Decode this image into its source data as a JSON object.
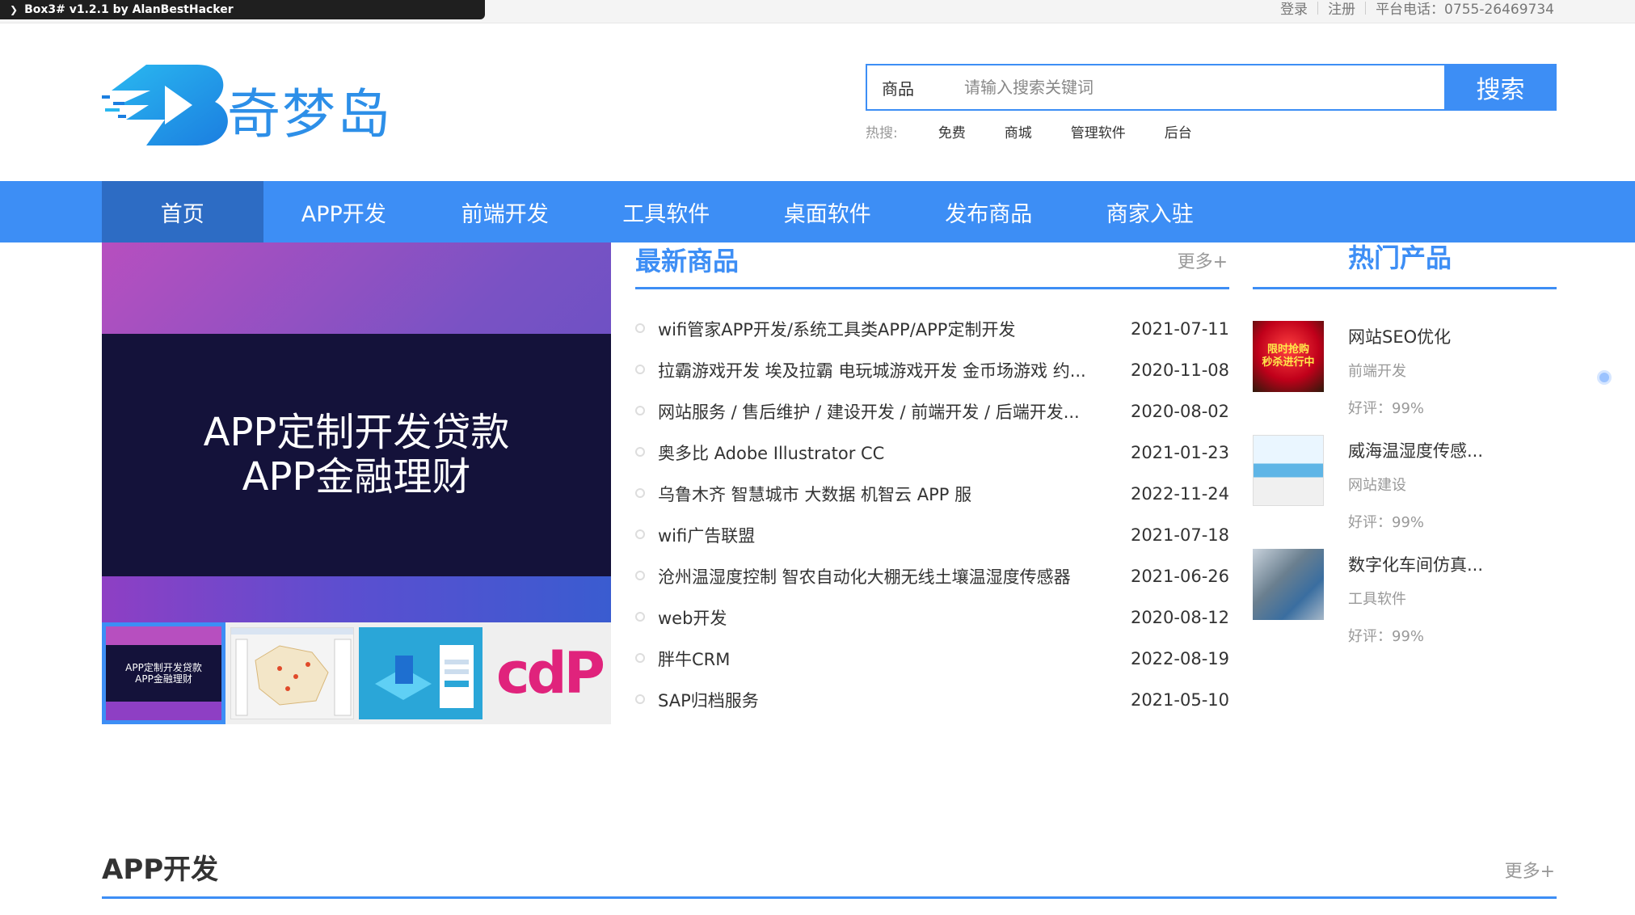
{
  "devbar": {
    "label": "Box3# v1.2.1 by AlanBestHacker"
  },
  "topbar": {
    "login": "登录",
    "register": "注册",
    "phone": "平台电话：0755-26469734"
  },
  "logo": {
    "text": "奇梦岛"
  },
  "search": {
    "category": "商品",
    "placeholder": "请输入搜索关键词",
    "button": "搜索"
  },
  "hot_search": {
    "label": "热搜:",
    "keywords": [
      "免费",
      "商城",
      "管理软件",
      "后台"
    ]
  },
  "nav": [
    "首页",
    "APP开发",
    "前端开发",
    "工具软件",
    "桌面软件",
    "发布商品",
    "商家入驻"
  ],
  "banner": {
    "line1": "APP定制开发贷款",
    "line2": "APP金融理财",
    "thumb1_line1": "APP定制开发贷款",
    "thumb1_line2": "APP金融理财",
    "thumb4_text": "cdP"
  },
  "latest": {
    "title": "最新商品",
    "more": "更多+",
    "items": [
      {
        "title": "wifi管家APP开发/系统工具类APP/APP定制开发",
        "date": "2021-07-11"
      },
      {
        "title": "拉霸游戏开发 埃及拉霸 电玩城游戏开发 金币场游戏 约...",
        "date": "2020-11-08"
      },
      {
        "title": "网站服务 / 售后维护 / 建设开发 / 前端开发 / 后端开发...",
        "date": "2020-08-02"
      },
      {
        "title": "奥多比 Adobe Illustrator CC",
        "date": "2021-01-23"
      },
      {
        "title": "乌鲁木齐 智慧城市 大数据 机智云 APP 服",
        "date": "2022-11-24"
      },
      {
        "title": "wifi广告联盟",
        "date": "2021-07-18"
      },
      {
        "title": "沧州温湿度控制 智农自动化大棚无线土壤温湿度传感器",
        "date": "2021-06-26"
      },
      {
        "title": "web开发",
        "date": "2020-08-12"
      },
      {
        "title": "胖牛CRM",
        "date": "2022-08-19"
      },
      {
        "title": "SAP归档服务",
        "date": "2021-05-10"
      }
    ]
  },
  "hot_products": {
    "title": "热门产品",
    "items": [
      {
        "name": "网站SEO优化",
        "category": "前端开发",
        "score": "好评：99%",
        "img_line1": "限时抢购",
        "img_line2": "秒杀进行中"
      },
      {
        "name": "威海温湿度传感...",
        "category": "网站建设",
        "score": "好评：99%"
      },
      {
        "name": "数字化车间仿真...",
        "category": "工具软件",
        "score": "好评：99%"
      }
    ]
  },
  "app_section": {
    "title": "APP开发",
    "more": "更多+"
  }
}
